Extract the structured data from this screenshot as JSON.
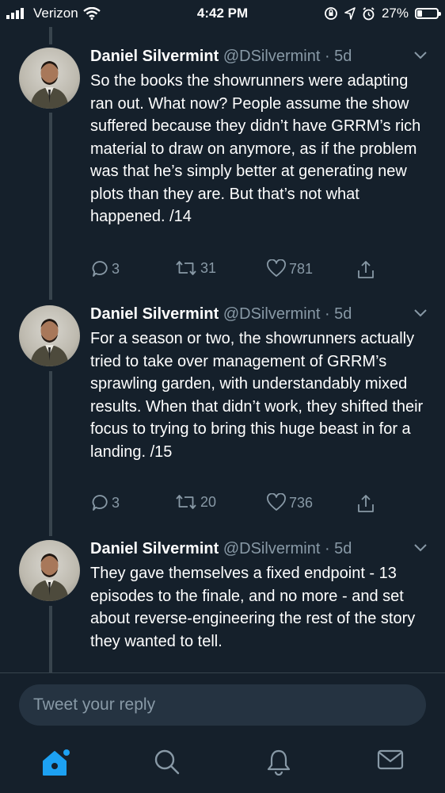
{
  "status_bar": {
    "carrier": "Verizon",
    "time": "4:42 PM",
    "battery_percent": "27%",
    "battery_level": 0.27,
    "icons": [
      "signal-icon",
      "wifi-icon",
      "orientation-lock-icon",
      "location-icon",
      "alarm-icon",
      "battery-icon"
    ]
  },
  "tweets": [
    {
      "name": "Daniel Silvermint",
      "handle": "@DSilvermint",
      "time": "· 5d",
      "text": "So the books the showrunners were adapting ran out. What now? People assume the show suffered because they didn’t have GRRM’s rich material to draw on anymore, as if the problem was that he’s simply better at generating new plots than they are. But that’s not what happened.  /14",
      "replies": "3",
      "retweets": "31",
      "likes": "781"
    },
    {
      "name": "Daniel Silvermint",
      "handle": "@DSilvermint",
      "time": "· 5d",
      "text": "For a season or two, the showrunners actually tried to take over management of GRRM’s sprawling garden, with understandably mixed results. When that didn’t work, they shifted their focus to trying to bring this huge beast in for a landing.  /15",
      "replies": "3",
      "retweets": "20",
      "likes": "736"
    },
    {
      "name": "Daniel Silvermint",
      "handle": "@DSilvermint",
      "time": "· 5d",
      "text": "They gave themselves a fixed endpoint - 13 episodes to the finale, and no more - and set about reverse-engineering the rest of the story they wanted to tell."
    }
  ],
  "reply": {
    "placeholder": "Tweet your reply"
  },
  "tabs": [
    "home-icon",
    "search-icon",
    "notifications-icon",
    "messages-icon"
  ],
  "colors": {
    "background": "#15202b",
    "accent": "#1da1f2",
    "secondary_text": "#8899a6"
  }
}
